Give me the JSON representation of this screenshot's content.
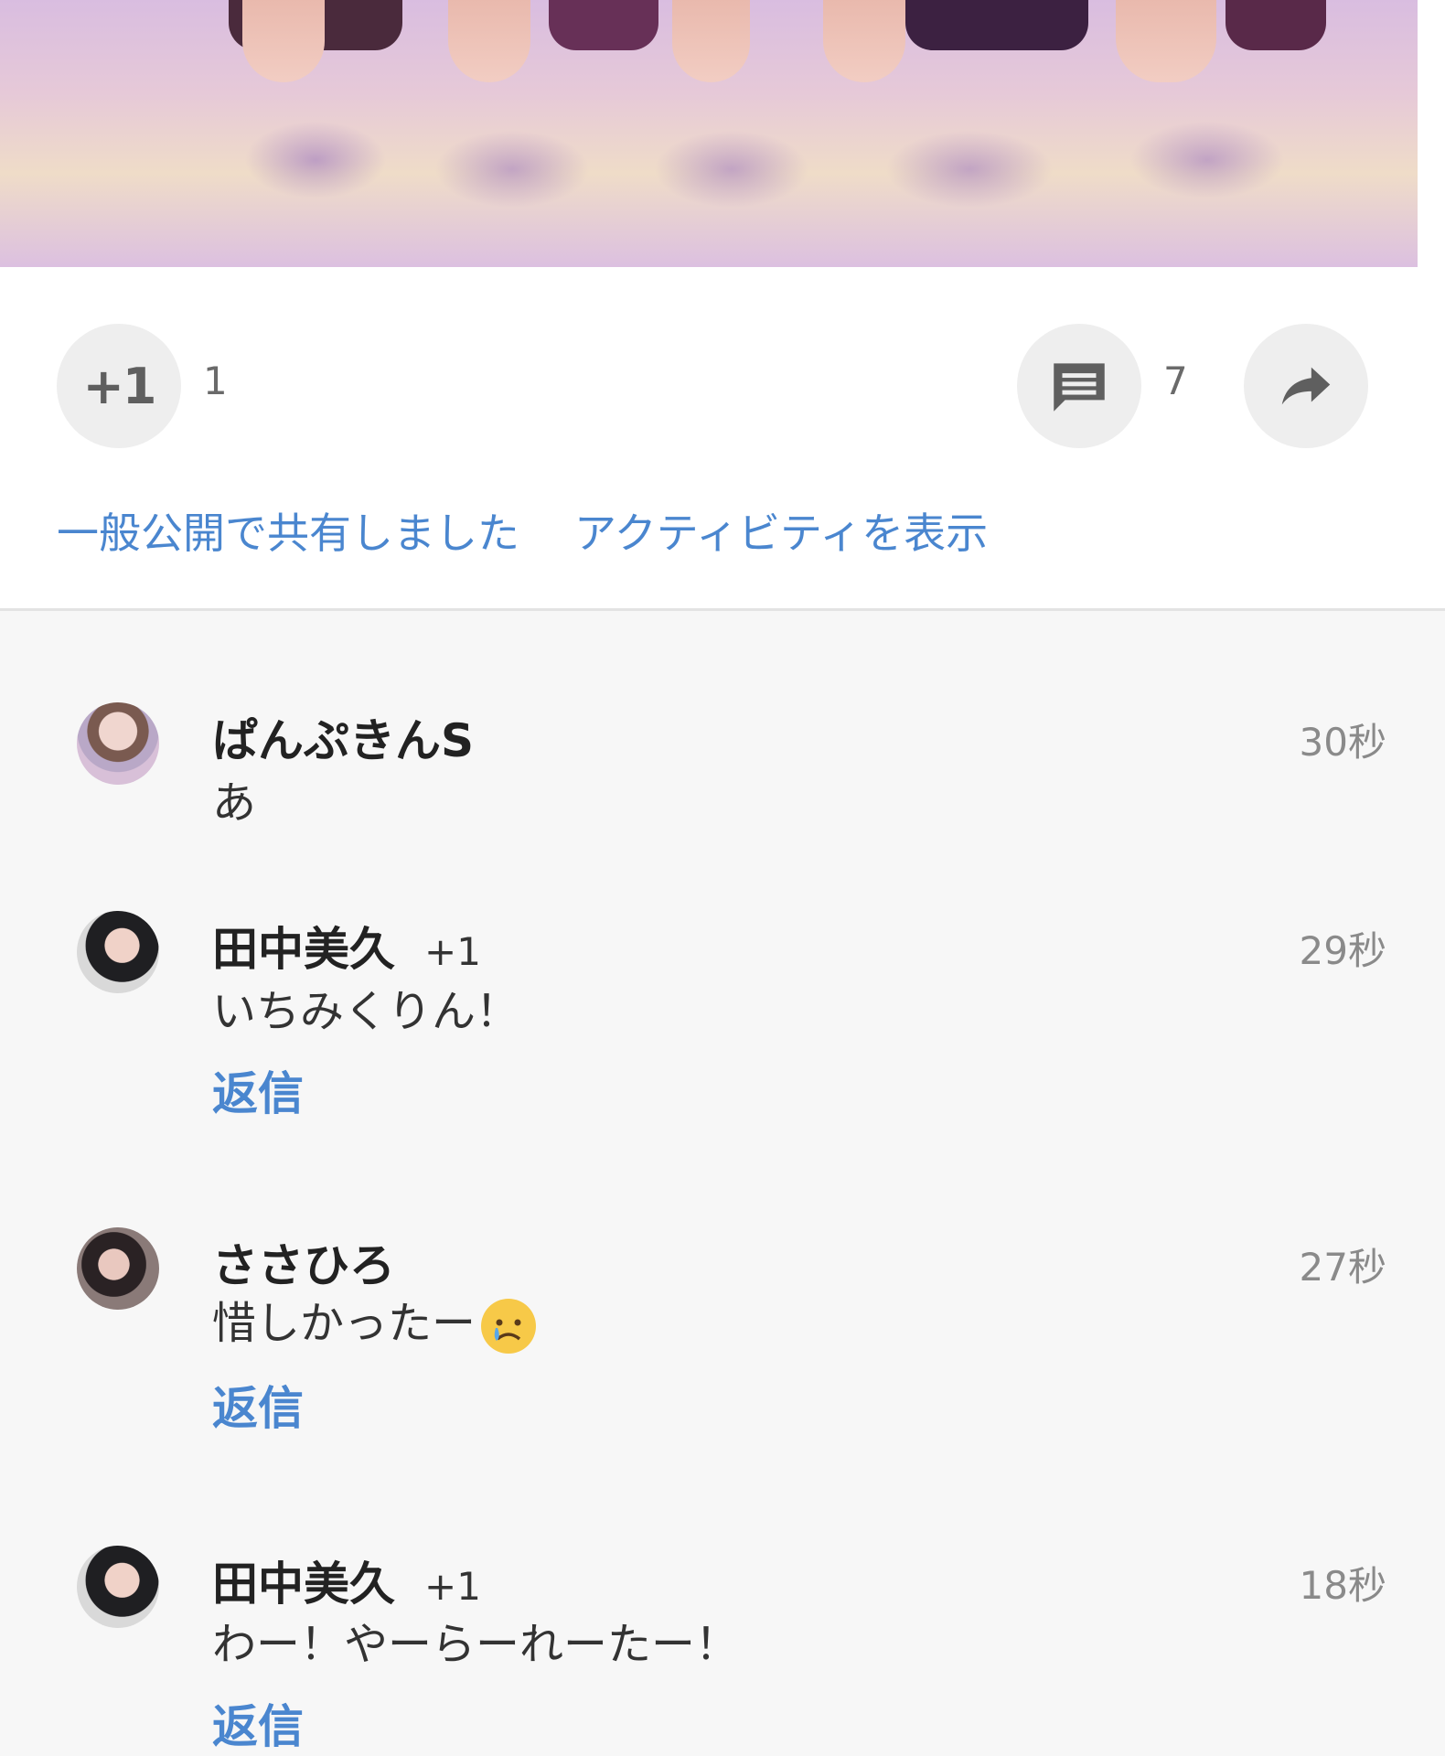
{
  "post": {
    "plus_label": "+1",
    "plus_count": "1",
    "comment_count": "7",
    "shared_publicly": "一般公開で共有しました",
    "show_activity": "アクティビティを表示"
  },
  "comments": [
    {
      "author": "ぱんぷきんS",
      "plus": "",
      "time": "30秒",
      "text": "あ",
      "reply": ""
    },
    {
      "author": "田中美久",
      "plus": "+1",
      "time": "29秒",
      "text": "いちみくりん！",
      "reply": "返信"
    },
    {
      "author": "ささひろ",
      "plus": "",
      "time": "27秒",
      "text": "惜しかったー",
      "reply": "返信"
    },
    {
      "author": "田中美久",
      "plus": "+1",
      "time": "18秒",
      "text": "わー！やーらーれーたー！",
      "reply": "返信"
    }
  ],
  "icons": {
    "plus_one": "plus-one-icon",
    "comment": "comment-icon",
    "share": "share-icon",
    "emoji": "crying-face-emoji"
  },
  "colors": {
    "link": "#4a86cf",
    "background": "#f7f7f7",
    "button_bg": "#eeeeee"
  }
}
